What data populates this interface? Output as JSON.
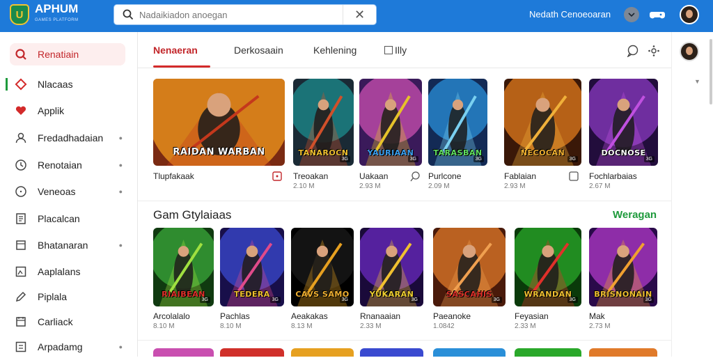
{
  "header": {
    "app_name": "APHUM",
    "app_tagline": "GAMES PLATFORM",
    "search_placeholder": "Nadaikiadon anoegan",
    "search_value": "Nadaikiadon anoegan",
    "user_label": "Nedath Cenoeoaran",
    "brand_color": "#1e7ad9"
  },
  "sidebar": {
    "items": [
      {
        "label": "Renatiain",
        "icon": "search-icon",
        "active": true
      },
      {
        "label": "Nlacaas",
        "icon": "diamond-icon",
        "marked": true
      },
      {
        "label": "Applik",
        "icon": "heart-icon"
      },
      {
        "label": "Fredadhadaian",
        "icon": "people-icon",
        "chevron": true
      },
      {
        "label": "Renotaian",
        "icon": "clock-icon",
        "chevron": true
      },
      {
        "label": "Veneoas",
        "icon": "chat-icon",
        "chevron": true
      },
      {
        "label": "Placalcan",
        "icon": "document-icon"
      },
      {
        "label": "Bhatanaran",
        "icon": "folder-icon",
        "chevron": true
      },
      {
        "label": "Aaplalans",
        "icon": "image-icon"
      },
      {
        "label": "Piplala",
        "icon": "pen-icon"
      },
      {
        "label": "Carliack",
        "icon": "calendar-icon"
      },
      {
        "label": "Arpadamg",
        "icon": "list-icon",
        "chevron": true
      }
    ]
  },
  "tabs": {
    "items": [
      "Nenaeran",
      "Derkosaain",
      "Kehlening",
      "Illy"
    ],
    "active_index": 0
  },
  "featured": {
    "games": [
      {
        "name": "Tlupfakaak",
        "size": "",
        "art_title": "RAIDAN WARBAN",
        "tag": "",
        "colors": [
          "#f39a1e",
          "#7a2a12",
          "#c4381c"
        ]
      },
      {
        "name": "Treoakan",
        "size": "2.10 M",
        "art_title": "TANAROCN",
        "tag": "3G",
        "colors": [
          "#1c8c8e",
          "#1a2a35",
          "#d0502a"
        ]
      },
      {
        "name": "Uakaan",
        "size": "2.93 M",
        "art_title": "YAURIAAN",
        "tag": "3G",
        "colors": [
          "#c94fb0",
          "#3a1a5a",
          "#e6c22a"
        ]
      },
      {
        "name": "Purlcone",
        "size": "2.09 M",
        "art_title": "TARASBAN",
        "tag": "3G",
        "colors": [
          "#2a8fd8",
          "#132a55",
          "#7ad0f0"
        ]
      },
      {
        "name": "Fablaian",
        "size": "2.93 M",
        "art_title": "NECOCAN",
        "tag": "3G",
        "colors": [
          "#e07a1c",
          "#3a1808",
          "#f0b03a"
        ]
      },
      {
        "name": "Fochlarbaias",
        "size": "2.67 M",
        "art_title": "DOCNOSE",
        "tag": "3G",
        "colors": [
          "#8a3ac0",
          "#220d3c",
          "#c050e0"
        ]
      }
    ]
  },
  "section": {
    "title": "Gam Gtylaiaas",
    "link": "Weragan",
    "games": [
      {
        "name": "Arcolalalo",
        "size": "8.10 M",
        "art_title": "RIAIBEAN",
        "tag": "3G",
        "colors": [
          "#3aa83a",
          "#103a10",
          "#a0e040"
        ]
      },
      {
        "name": "Pachlas",
        "size": "8.10 M",
        "art_title": "TEDERA",
        "tag": "3G",
        "colors": [
          "#3a4ad0",
          "#180f4a",
          "#e04a8a"
        ]
      },
      {
        "name": "Aeakakas",
        "size": "8.13 M",
        "art_title": "CAVS SAMO",
        "tag": "3G",
        "colors": [
          "#1a1a1a",
          "#000000",
          "#e6a020"
        ]
      },
      {
        "name": "Rnanaaian",
        "size": "2.33 M",
        "art_title": "YUKARAN",
        "tag": "3G",
        "colors": [
          "#6a2ac0",
          "#1a0a3a",
          "#f0c030"
        ]
      },
      {
        "name": "Paeanoke",
        "size": "1.0842",
        "art_title": "SASCAHIS",
        "tag": "3G",
        "colors": [
          "#e07a2a",
          "#4a1a0a",
          "#f0a050"
        ]
      },
      {
        "name": "Feyasian",
        "size": "2.33 M",
        "art_title": "WRANDAN",
        "tag": "3G",
        "colors": [
          "#2aa82a",
          "#0a3a0a",
          "#e0302a"
        ]
      },
      {
        "name": "Mak",
        "size": "2.73 M",
        "art_title": "BRISNONAIN",
        "tag": "3G",
        "colors": [
          "#b03ac8",
          "#2a0a4a",
          "#f0a030"
        ]
      }
    ]
  }
}
